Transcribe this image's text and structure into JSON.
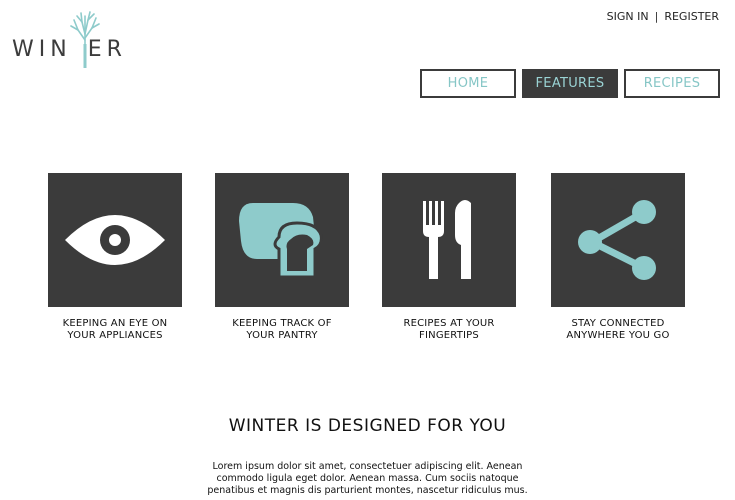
{
  "brand": {
    "name_part1": "WIN",
    "name_part2": "ER"
  },
  "account": {
    "sign_in": "SIGN IN",
    "separator": "|",
    "register": "REGISTER"
  },
  "nav": {
    "items": [
      {
        "label": "HOME",
        "active": false
      },
      {
        "label": "FEATURES",
        "active": true
      },
      {
        "label": "RECIPES",
        "active": false
      }
    ]
  },
  "features": [
    {
      "icon": "eye-icon",
      "line1": "KEEPING AN EYE ON",
      "line2": "YOUR APPLIANCES"
    },
    {
      "icon": "bread-icon",
      "line1": "KEEPING TRACK OF",
      "line2": "YOUR PANTRY"
    },
    {
      "icon": "fork-knife-icon",
      "line1": "RECIPES AT YOUR",
      "line2": "FINGERTIPS"
    },
    {
      "icon": "share-icon",
      "line1": "STAY CONNECTED",
      "line2": "ANYWHERE YOU GO"
    }
  ],
  "tagline": "WINTER IS DESIGNED FOR YOU",
  "body_copy": {
    "lines": [
      "Lorem ipsum dolor sit amet, consectetuer adipiscing elit. Aenean",
      "commodo ligula eget dolor. Aenean massa. Cum sociis natoque",
      "penatibus et magnis dis parturient montes, nascetur ridiculus mus."
    ]
  },
  "colors": {
    "accent": "#86c6c6",
    "dark": "#3b3b3b",
    "tile_icon_light": "#ffffff",
    "tile_icon_accent": "#8ecbcb"
  }
}
